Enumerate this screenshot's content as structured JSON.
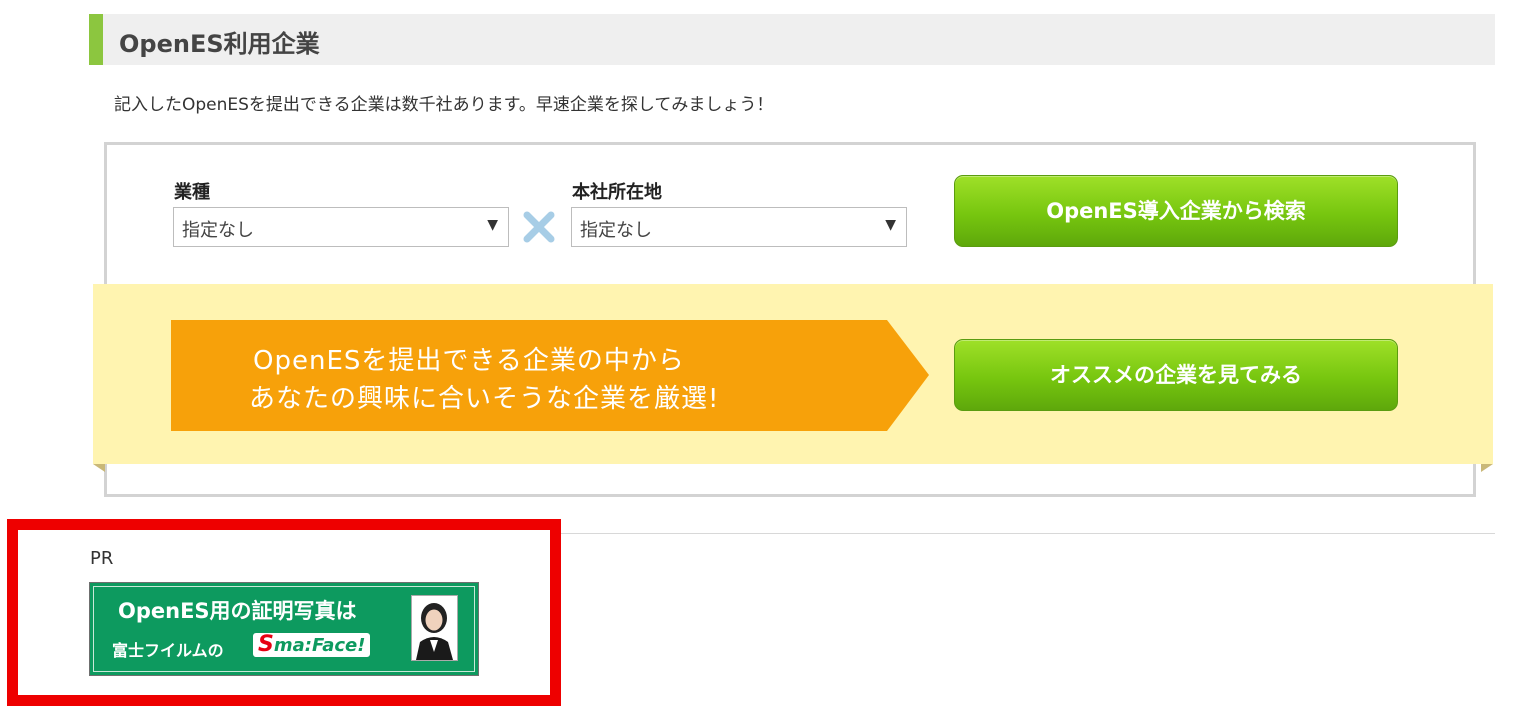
{
  "section": {
    "title": "OpenES利用企業"
  },
  "intro_text": "記入したOpenESを提出できる企業は数千社あります。早速企業を探してみましょう！",
  "search": {
    "industry_label": "業種",
    "industry_value": "指定なし",
    "location_label": "本社所在地",
    "location_value": "指定なし",
    "search_button": "OpenES導入企業から検索"
  },
  "recommend": {
    "line1": "OpenESを提出できる企業の中から",
    "line2": "あなたの興味に合いそうな企業を厳選!",
    "button": "オススメの企業を見てみる"
  },
  "pr": {
    "label": "PR",
    "banner_line1": "OpenES用の証明写真は",
    "banner_line2": "富士フイルムの",
    "banner_logo_s": "S",
    "banner_logo_rest": "ma:Face!"
  },
  "colors": {
    "accent_green": "#8cc63f",
    "button_green": "#77c60f",
    "orange": "#f7a10a",
    "band_yellow": "#fff4b0",
    "highlight_red": "#ee0000",
    "banner_green": "#0d9a5f"
  },
  "icons": {
    "times": "times-icon",
    "dropdown": "chevron-down-icon"
  }
}
